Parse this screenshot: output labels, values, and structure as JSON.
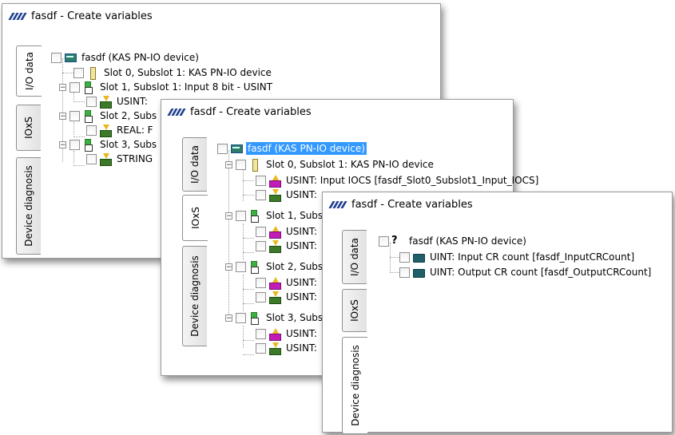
{
  "windows": [
    {
      "title": "fasdf - Create variables",
      "tabs": [
        "I/O data",
        "IOxS",
        "Device diagnosis"
      ],
      "tree": {
        "root": "fasdf (KAS PN-IO device)",
        "items": [
          {
            "label": "Slot 0, Subslot 1: KAS PN-IO device",
            "icon": "slot-icon"
          },
          {
            "label": "Slot 1, Subslot 1: Input  8 bit - USINT",
            "icon": "input-slot-icon"
          },
          {
            "label": "USINT:",
            "icon": "input-variable-icon"
          },
          {
            "label": "Slot 2, Subs",
            "icon": "input-slot-icon"
          },
          {
            "label": "REAL: F",
            "icon": "input-variable-icon"
          },
          {
            "label": "Slot 3, Subs",
            "icon": "input-slot-icon"
          },
          {
            "label": "STRING",
            "icon": "input-variable-icon"
          }
        ]
      }
    },
    {
      "title": "fasdf - Create variables",
      "tabs": [
        "I/O data",
        "IOxS",
        "Device diagnosis"
      ],
      "tree": {
        "root": "fasdf (KAS PN-IO device)",
        "items": [
          {
            "label": "Slot 0, Subslot 1: KAS PN-IO device"
          },
          {
            "label": "USINT: Input IOCS [fasdf_Slot0_Subslot1_Input_IOCS]"
          },
          {
            "label": "USINT:"
          },
          {
            "label": "Slot 1, Subs"
          },
          {
            "label": "USINT:"
          },
          {
            "label": "USINT:"
          },
          {
            "label": "Slot 2, Subs"
          },
          {
            "label": "USINT:"
          },
          {
            "label": "USINT:"
          },
          {
            "label": "Slot 3, Subs"
          },
          {
            "label": "USINT:"
          },
          {
            "label": "USINT:"
          }
        ]
      }
    },
    {
      "title": "fasdf - Create variables",
      "tabs": [
        "I/O data",
        "IOxS",
        "Device diagnosis"
      ],
      "tree": {
        "root": "fasdf (KAS PN-IO device)",
        "items": [
          {
            "label": "UINT: Input CR count [fasdf_InputCRCount]"
          },
          {
            "label": "UINT: Output CR count [fasdf_OutputCRCount]"
          }
        ]
      }
    }
  ]
}
